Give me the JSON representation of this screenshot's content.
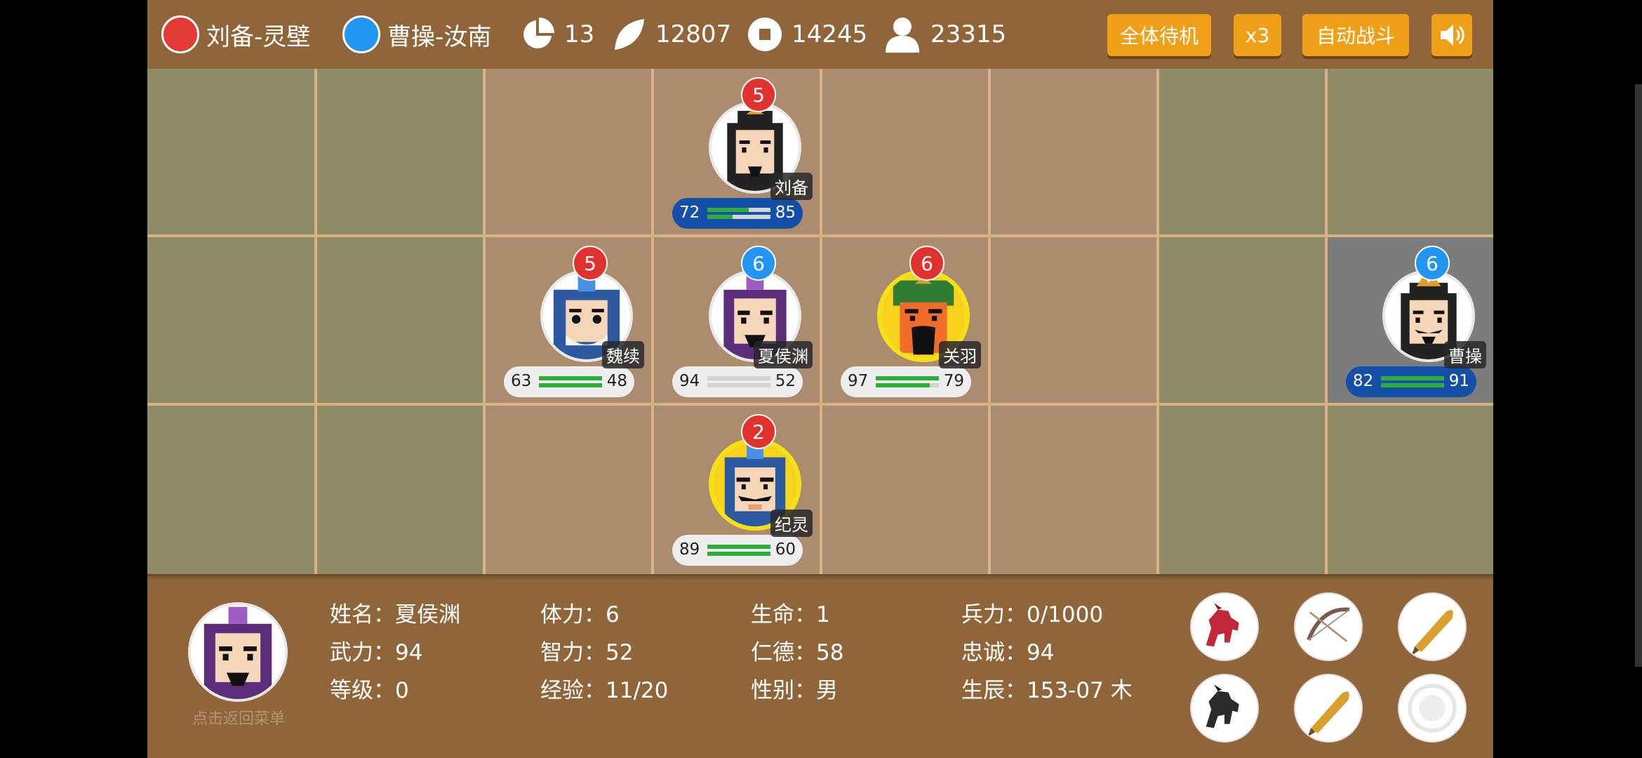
{
  "header": {
    "faction_player": {
      "name": "刘备-灵壁",
      "color": "#e53935"
    },
    "faction_enemy": {
      "name": "曹操-汝南",
      "color": "#2196f3"
    },
    "turn": "13",
    "food": "12807",
    "gold": "14245",
    "population": "23315",
    "buttons": {
      "all_standby": "全体待机",
      "speed": "x3",
      "auto_battle": "自动战斗"
    },
    "sound_icon": "speaker-icon"
  },
  "colors": {
    "background": "#90653a",
    "tile_grass": "#8e8b66",
    "tile_road": "#ab8c6e",
    "button": "#f0a018",
    "hp_green": "#2fae3b",
    "ally_plate": "#1450a8",
    "level_red": "#e0322f",
    "level_blue": "#2196f3"
  },
  "units": [
    {
      "name": "刘备",
      "level": "5",
      "level_color": "red",
      "attack": "72",
      "defense": "85",
      "attack_ratio": 0.65,
      "defense_ratio": 0.4,
      "ally_plate": true,
      "highlight": false,
      "face": "liubei"
    },
    {
      "name": "魏续",
      "level": "5",
      "level_color": "red",
      "attack": "63",
      "defense": "48",
      "attack_ratio": 1.0,
      "defense_ratio": 1.0,
      "ally_plate": false,
      "highlight": false,
      "face": "weixu"
    },
    {
      "name": "夏侯渊",
      "level": "6",
      "level_color": "blue",
      "attack": "94",
      "defense": "52",
      "attack_ratio": 0.0,
      "defense_ratio": 0.0,
      "ally_plate": false,
      "highlight": false,
      "face": "xiahouyuan"
    },
    {
      "name": "关羽",
      "level": "6",
      "level_color": "red",
      "attack": "97",
      "defense": "79",
      "attack_ratio": 1.0,
      "defense_ratio": 0.85,
      "ally_plate": false,
      "highlight": true,
      "face": "guanyu"
    },
    {
      "name": "曹操",
      "level": "6",
      "level_color": "blue",
      "attack": "82",
      "defense": "91",
      "attack_ratio": 1.0,
      "defense_ratio": 1.0,
      "ally_plate": true,
      "highlight": false,
      "face": "caocao"
    },
    {
      "name": "纪灵",
      "level": "2",
      "level_color": "red",
      "attack": "89",
      "defense": "60",
      "attack_ratio": 1.0,
      "defense_ratio": 1.0,
      "ally_plate": false,
      "highlight": true,
      "face": "jiling"
    }
  ],
  "panel": {
    "back_label": "点击返回菜单",
    "rows": [
      [
        {
          "label": "姓名：",
          "value": "夏侯渊"
        },
        {
          "label": "体力：",
          "value": "6"
        },
        {
          "label": "生命：",
          "value": "1"
        },
        {
          "label": "兵力：",
          "value": "0/1000"
        }
      ],
      [
        {
          "label": "武力：",
          "value": "94"
        },
        {
          "label": "智力：",
          "value": "52"
        },
        {
          "label": "仁德：",
          "value": "58"
        },
        {
          "label": "忠诚：",
          "value": "94"
        }
      ],
      [
        {
          "label": "等级：",
          "value": "0"
        },
        {
          "label": "经验：",
          "value": "11/20"
        },
        {
          "label": "性别：",
          "value": "男"
        },
        {
          "label": "生辰：",
          "value": "153-07 木"
        }
      ]
    ],
    "items": [
      "red-horse-icon",
      "bow-icon",
      "broadsword-icon",
      "black-horse-icon",
      "broadsword-icon",
      "empty-slot-icon"
    ]
  }
}
